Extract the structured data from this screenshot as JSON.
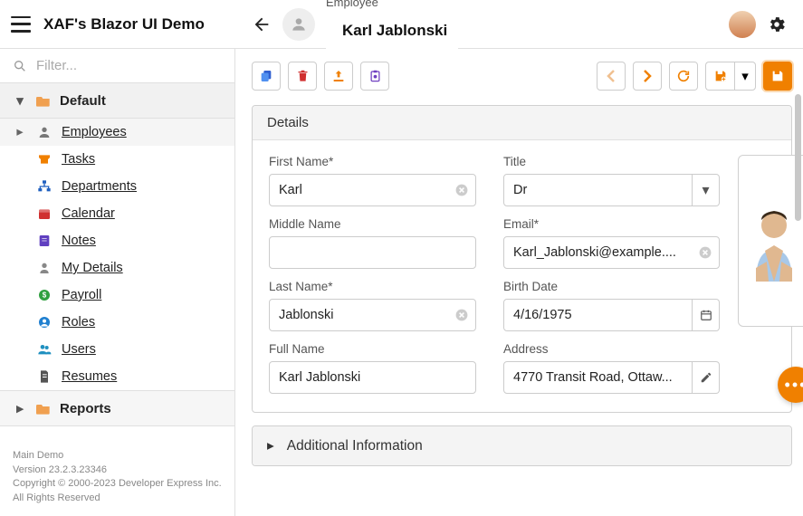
{
  "appTitle": "XAF's Blazor UI Demo",
  "filterPlaceholder": "Filter...",
  "sidebar": {
    "groupDefault": "Default",
    "groupReports": "Reports",
    "items": [
      {
        "label": "Employees",
        "icon": "person",
        "color": "#777",
        "active": true,
        "chevron": true
      },
      {
        "label": "Tasks",
        "icon": "inbox",
        "color": "#f08000"
      },
      {
        "label": "Departments",
        "icon": "sitemap",
        "color": "#2060c0"
      },
      {
        "label": "Calendar",
        "icon": "calendar",
        "color": "#d03030"
      },
      {
        "label": "Notes",
        "icon": "note",
        "color": "#6040c0"
      },
      {
        "label": "My Details",
        "icon": "user",
        "color": "#888"
      },
      {
        "label": "Payroll",
        "icon": "dollar",
        "color": "#30a040"
      },
      {
        "label": "Roles",
        "icon": "circle-user",
        "color": "#2080d0"
      },
      {
        "label": "Users",
        "icon": "users",
        "color": "#2090c0"
      },
      {
        "label": "Resumes",
        "icon": "doc",
        "color": "#555"
      }
    ]
  },
  "header": {
    "sub": "Employee",
    "main": "Karl Jablonski"
  },
  "details": {
    "title": "Details",
    "firstNameLabel": "First Name*",
    "firstName": "Karl",
    "middleNameLabel": "Middle Name",
    "middleName": "",
    "lastNameLabel": "Last Name*",
    "lastName": "Jablonski",
    "fullNameLabel": "Full Name",
    "fullName": "Karl Jablonski",
    "titleLabel": "Title",
    "titleValue": "Dr",
    "emailLabel": "Email*",
    "email": "Karl_Jablonski@example....",
    "birthDateLabel": "Birth Date",
    "birthDate": "4/16/1975",
    "addressLabel": "Address",
    "address": "4770 Transit Road, Ottaw..."
  },
  "additionalInfo": "Additional Information",
  "footer": {
    "line1": "Main Demo",
    "line2": "Version 23.2.3.23346",
    "line3": "Copyright © 2000-2023 Developer Express Inc.",
    "line4": "All Rights Reserved"
  }
}
